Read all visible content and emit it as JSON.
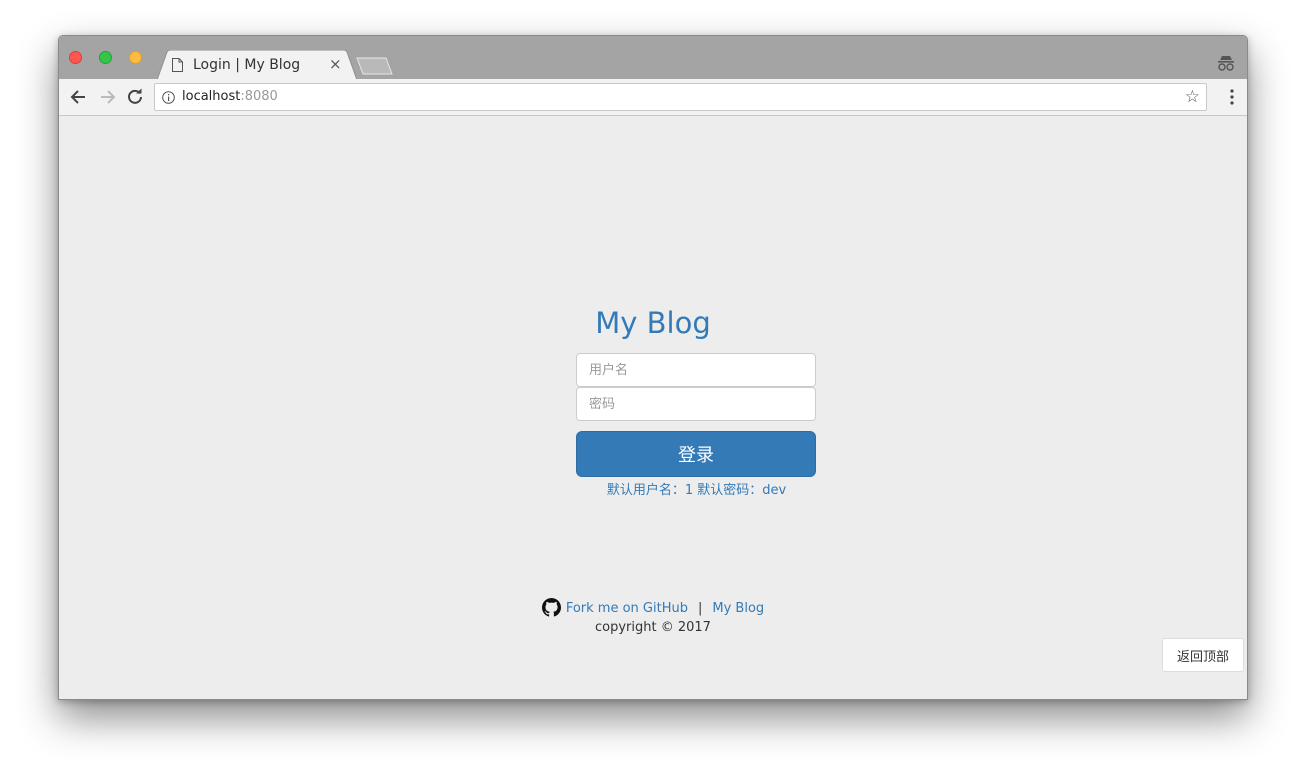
{
  "browser": {
    "tab_title": "Login | My Blog",
    "tab_close": "×",
    "url_host": "localhost",
    "url_port": ":8080",
    "star": "☆"
  },
  "login": {
    "brand": "My Blog",
    "username_placeholder": "用户名",
    "password_placeholder": "密码",
    "submit_label": "登录",
    "hint": "默认用户名：1 默认密码：dev"
  },
  "footer": {
    "github_link": "Fork me on GitHub",
    "separator": "|",
    "blog_link": "My Blog",
    "copyright": "copyright © 2017"
  },
  "back_to_top": "返回顶部",
  "colors": {
    "accent": "#337ab7",
    "page_bg": "#ededee",
    "titlebar": "#a4a4a4"
  }
}
